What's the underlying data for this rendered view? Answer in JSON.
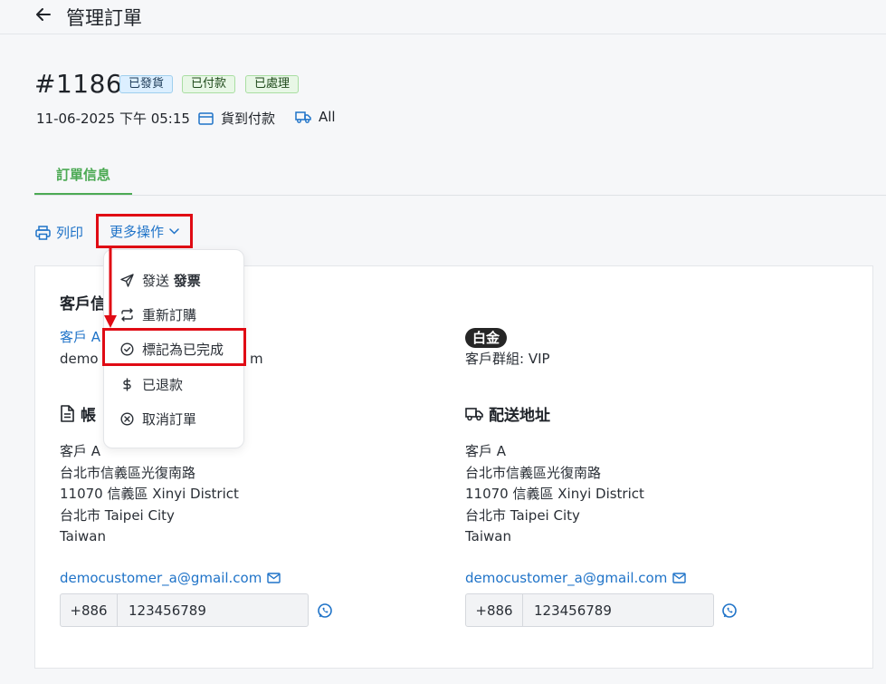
{
  "header": {
    "title": "管理訂單"
  },
  "order": {
    "number": "#1186",
    "badges": [
      "已發貨",
      "已付款",
      "已處理"
    ],
    "datetime": "11-06-2025 下午 05:15",
    "payment": "貨到付款",
    "shipping": "All"
  },
  "tabs": [
    {
      "label": "訂單信息"
    }
  ],
  "actions": {
    "print": "列印",
    "more": "更多操作"
  },
  "menu": {
    "items": [
      {
        "label": "發送",
        "bold": "發票"
      },
      {
        "label": "重新訂購"
      },
      {
        "label": "標記為已完成"
      },
      {
        "label": "已退款"
      },
      {
        "label": "取消訂單"
      }
    ]
  },
  "customer": {
    "section_title_partial": "客戶信",
    "name_partial": "客戶 A",
    "email_partial_left": "demo",
    "email_partial_right": "m",
    "tier": "白金",
    "group": "客戶群組: VIP"
  },
  "billing": {
    "title_partial": "帳",
    "lines": [
      "客戶 A",
      "台北市信義區光復南路",
      "11070 信義區 Xinyi District",
      "台北市 Taipei City",
      "Taiwan"
    ],
    "email": "democustomer_a@gmail.com",
    "phone_cc": "+886",
    "phone": "123456789"
  },
  "shipping_address": {
    "title": "配送地址",
    "lines": [
      "客戶 A",
      "台北市信義區光復南路",
      "11070 信義區 Xinyi District",
      "台北市 Taipei City",
      "Taiwan"
    ],
    "email": "democustomer_a@gmail.com",
    "phone_cc": "+886",
    "phone": "123456789"
  },
  "colors": {
    "accent_green": "#4caa54",
    "link_blue": "#1f73c8",
    "highlight_red": "#e00b14"
  }
}
